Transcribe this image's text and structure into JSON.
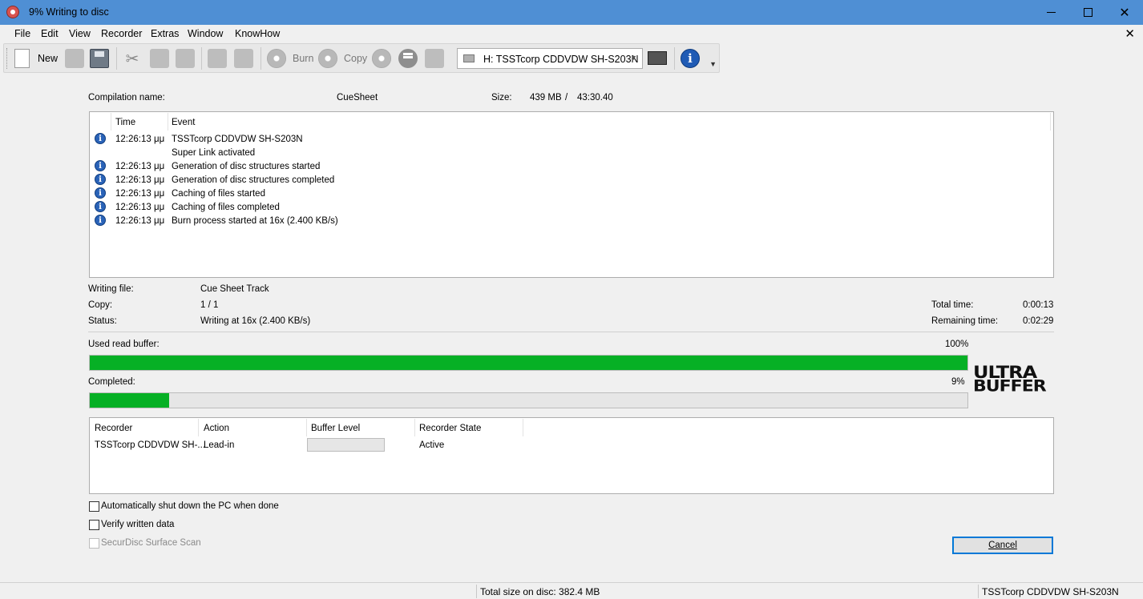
{
  "window": {
    "title": "9% Writing to disc"
  },
  "menu": [
    "File",
    "Edit",
    "View",
    "Recorder",
    "Extras",
    "Window",
    "KnowHow"
  ],
  "toolbar": {
    "new_label": "New",
    "burn_label": "Burn",
    "copy_label": "Copy",
    "drive": "H: TSSTcorp CDDVDW SH-S203N"
  },
  "compilation": {
    "name_label": "Compilation name:",
    "name_value": "CueSheet",
    "size_label": "Size:",
    "size_mb": "439 MB",
    "size_sep": "/",
    "size_time": "43:30.40"
  },
  "log": {
    "col_time": "Time",
    "col_event": "Event",
    "rows": [
      {
        "time": "12:26:13 μμ",
        "event": "TSSTcorp CDDVDW SH-S203N",
        "icon": true
      },
      {
        "time": "",
        "event": "Super Link activated",
        "icon": false
      },
      {
        "time": "12:26:13 μμ",
        "event": "Generation of disc structures started",
        "icon": true
      },
      {
        "time": "12:26:13 μμ",
        "event": "Generation of disc structures completed",
        "icon": true
      },
      {
        "time": "12:26:13 μμ",
        "event": "Caching of files started",
        "icon": true
      },
      {
        "time": "12:26:13 μμ",
        "event": "Caching of files completed",
        "icon": true
      },
      {
        "time": "12:26:13 μμ",
        "event": "Burn process started at 16x (2.400 KB/s)",
        "icon": true
      }
    ]
  },
  "info": {
    "writing_file_label": "Writing file:",
    "writing_file_value": "Cue Sheet Track",
    "copy_label": "Copy:",
    "copy_value": "1 / 1",
    "status_label": "Status:",
    "status_value": "Writing at 16x (2.400 KB/s)",
    "total_time_label": "Total time:",
    "total_time_value": "0:00:13",
    "remaining_time_label": "Remaining time:",
    "remaining_time_value": "0:02:29"
  },
  "progress": {
    "buffer_label": "Used read buffer:",
    "buffer_percent_text": "100%",
    "buffer_fraction": 1.0,
    "completed_label": "Completed:",
    "completed_percent_text": "9%",
    "completed_fraction": 0.09
  },
  "logo": {
    "line1": "ULTRA",
    "line2": "BUFFER"
  },
  "recorders": {
    "col_recorder": "Recorder",
    "col_action": "Action",
    "col_buffer": "Buffer Level",
    "col_state": "Recorder State",
    "rows": [
      {
        "recorder": "TSSTcorp CDDVDW SH-...",
        "action": "Lead-in",
        "state": "Active"
      }
    ]
  },
  "options": {
    "shutdown_label": "Automatically shut down the PC when done",
    "verify_label": "Verify written data",
    "securdisc_label": "SecurDisc Surface Scan"
  },
  "buttons": {
    "cancel": "Cancel"
  },
  "statusbar": {
    "total_size": "Total size on disc: 382.4 MB",
    "drive": "TSSTcorp CDDVDW SH-S203N"
  },
  "colors": {
    "progress_fill": "#06b025",
    "titlebar": "#4f8fd4"
  }
}
